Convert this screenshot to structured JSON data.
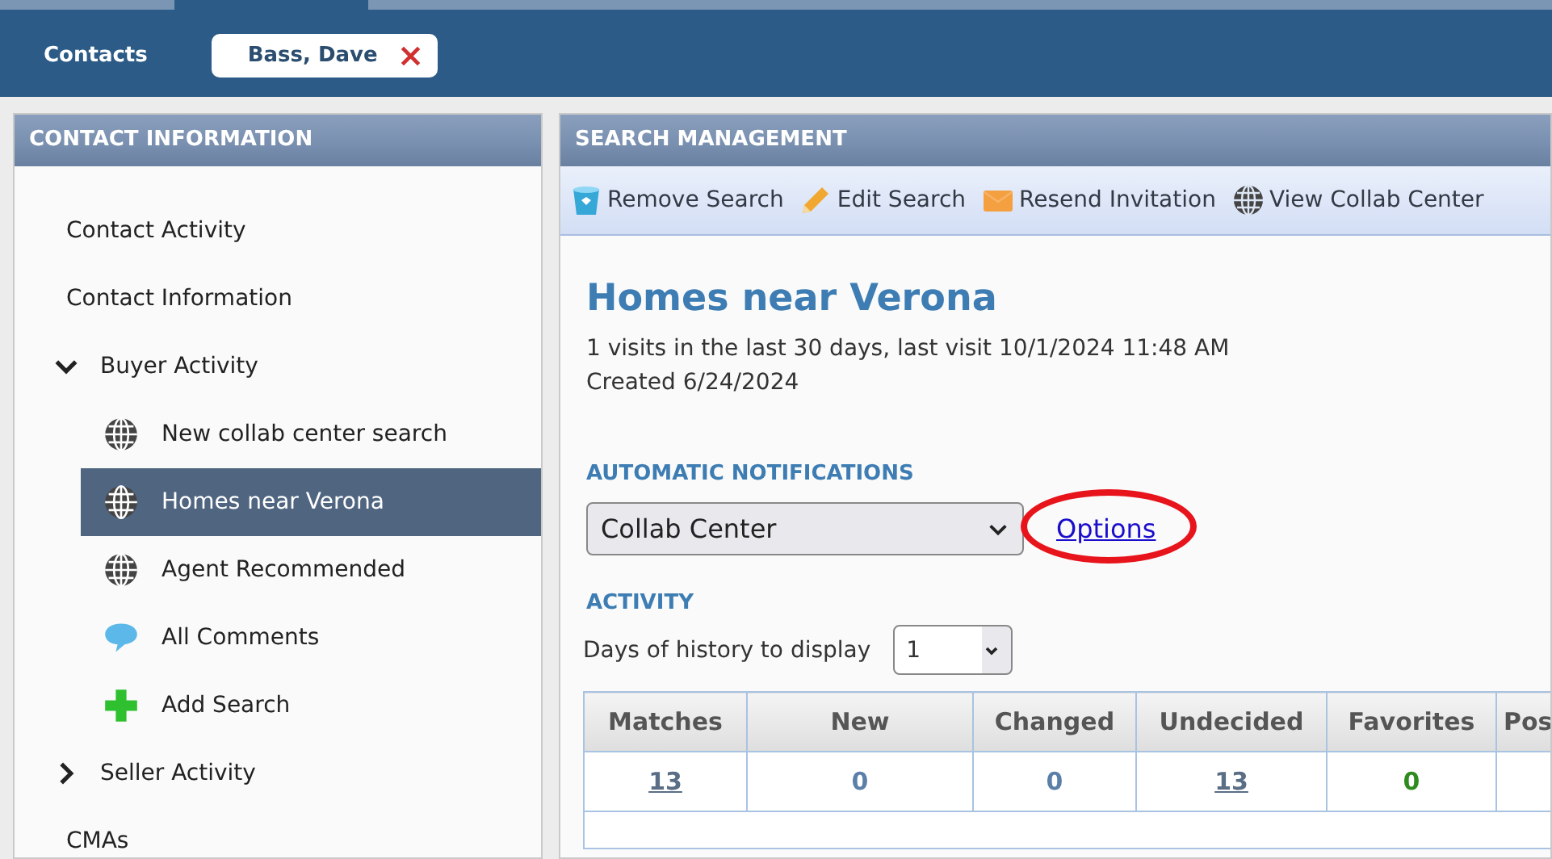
{
  "top_bar": {
    "tabs": [
      {
        "label": "Contacts",
        "selected": false
      },
      {
        "label": "Bass, Dave",
        "selected": true,
        "close_label": "×"
      }
    ]
  },
  "contact_panel": {
    "title": "CONTACT INFORMATION",
    "items": [
      {
        "label": "Contact Activity",
        "selected": false
      },
      {
        "label": "Contact Information",
        "selected": false
      },
      {
        "label": "Buyer Activity",
        "selected": false,
        "expanded": true,
        "children": [
          {
            "label": "New collab center search",
            "kind": "globe",
            "selected": false
          },
          {
            "label": "Homes near Verona",
            "kind": "globe",
            "selected": true
          },
          {
            "label": "Agent Recommended",
            "kind": "globe",
            "selected": false
          },
          {
            "label": "All Comments",
            "kind": "comment",
            "selected": false
          },
          {
            "label": "Add Search",
            "kind": "plus",
            "selected": false
          }
        ]
      },
      {
        "label": "Seller Activity",
        "selected": false,
        "expanded": false
      },
      {
        "label": "CMAs",
        "selected": false
      }
    ]
  },
  "search_panel": {
    "title": "SEARCH MANAGEMENT",
    "toolbar": [
      {
        "label": "Remove Search",
        "kind": "bin"
      },
      {
        "label": "Edit Search",
        "kind": "pencil"
      },
      {
        "label": "Resend Invitation",
        "kind": "envelope"
      },
      {
        "label": "View Collab Center",
        "kind": "globe"
      }
    ],
    "heading": "Homes near Verona",
    "info_lines": [
      "1 visits in the last 30 days, last visit 10/1/2024 11:48 AM",
      "Created 6/24/2024"
    ],
    "notifications": {
      "title": "AUTOMATIC NOTIFICATIONS",
      "value": "Collab Center",
      "link": "Options",
      "highlighted": true
    },
    "activity": {
      "title": "ACTIVITY",
      "days_label": "Days of history to display",
      "days_value": "1",
      "table": {
        "columns": [
          "Matches",
          "New",
          "Changed",
          "Undecided",
          "Favorites",
          "Pos"
        ],
        "rows": [
          [
            {
              "text": "13",
              "link": true,
              "color": "#5a6e86"
            },
            {
              "text": "0",
              "link": false,
              "color": "#5a7fa8"
            },
            {
              "text": "0",
              "link": false,
              "color": "#5a7fa8"
            },
            {
              "text": "13",
              "link": true,
              "color": "#5a6e86"
            },
            {
              "text": "0",
              "link": false,
              "color": "#2e8b1e"
            }
          ]
        ]
      }
    }
  }
}
